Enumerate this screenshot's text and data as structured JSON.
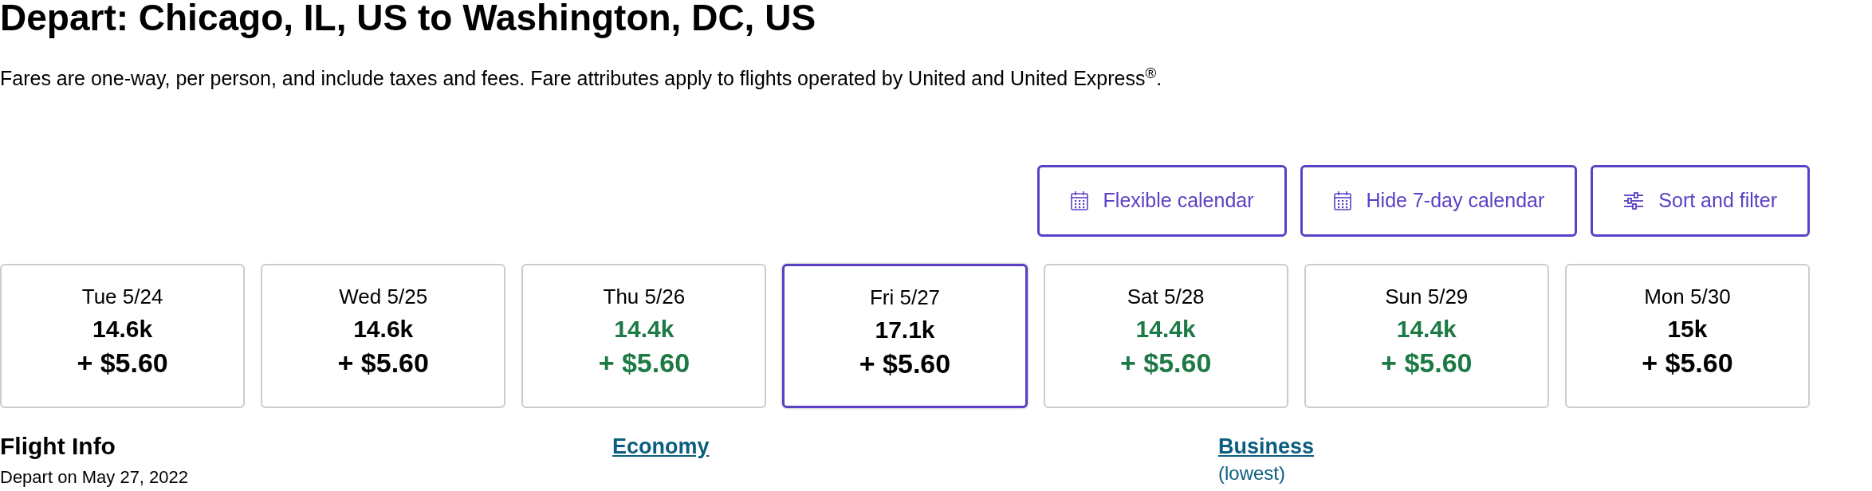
{
  "title": "Depart: Chicago, IL, US to Washington, DC, US",
  "note": "Fares are one-way, per person, and include taxes and fees. Fare attributes apply to flights operated by United and United Express$^{®}$.",
  "buttons": [
    {
      "label": "Flexible calendar",
      "kind": "calendar"
    },
    {
      "label": "Hide 7-day calendar",
      "kind": "calendar"
    },
    {
      "label": "Sort and filter",
      "kind": "filter"
    }
  ],
  "days": [
    {
      "date": "Tue 5/24",
      "miles": "14.6k",
      "fee": "+ $5.60",
      "lowest": false,
      "selected": false
    },
    {
      "date": "Wed 5/25",
      "miles": "14.6k",
      "fee": "+ $5.60",
      "lowest": false,
      "selected": false
    },
    {
      "date": "Thu 5/26",
      "miles": "14.4k",
      "fee": "+ $5.60",
      "lowest": true,
      "selected": false
    },
    {
      "date": "Fri 5/27",
      "miles": "17.1k",
      "fee": "+ $5.60",
      "lowest": false,
      "selected": true
    },
    {
      "date": "Sat 5/28",
      "miles": "14.4k",
      "fee": "+ $5.60",
      "lowest": true,
      "selected": false
    },
    {
      "date": "Sun 5/29",
      "miles": "14.4k",
      "fee": "+ $5.60",
      "lowest": true,
      "selected": false
    },
    {
      "date": "Mon 5/30",
      "miles": "15k",
      "fee": "+ $5.60",
      "lowest": false,
      "selected": false
    }
  ],
  "table_header": {
    "heading": "Flight Info",
    "subheading": "Depart on May 27, 2022",
    "columns": [
      {
        "label": "Economy"
      },
      {
        "label": "Business",
        "note": "(lowest)"
      }
    ]
  }
}
